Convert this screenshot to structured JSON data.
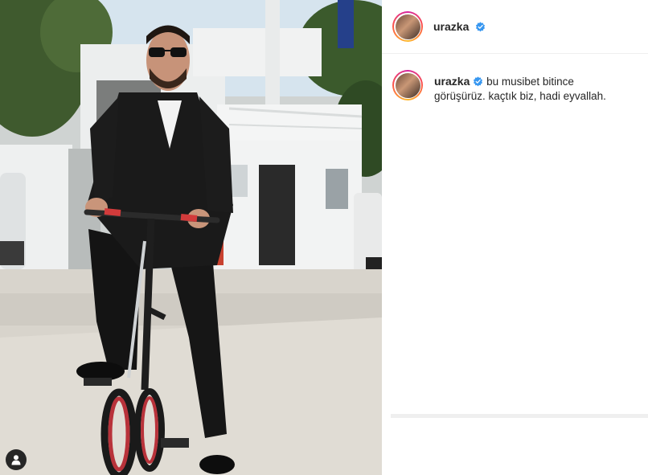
{
  "post": {
    "username": "urazka",
    "verified": true,
    "caption": "bu musibet bitince görüşürüz. kaçtık biz, hadi eyvallah."
  },
  "icons": {
    "verified": "verified-badge-icon",
    "user_tag": "user-tag-icon"
  },
  "colors": {
    "verified_blue": "#3897f0",
    "text": "#262626",
    "divider": "#efefef"
  }
}
